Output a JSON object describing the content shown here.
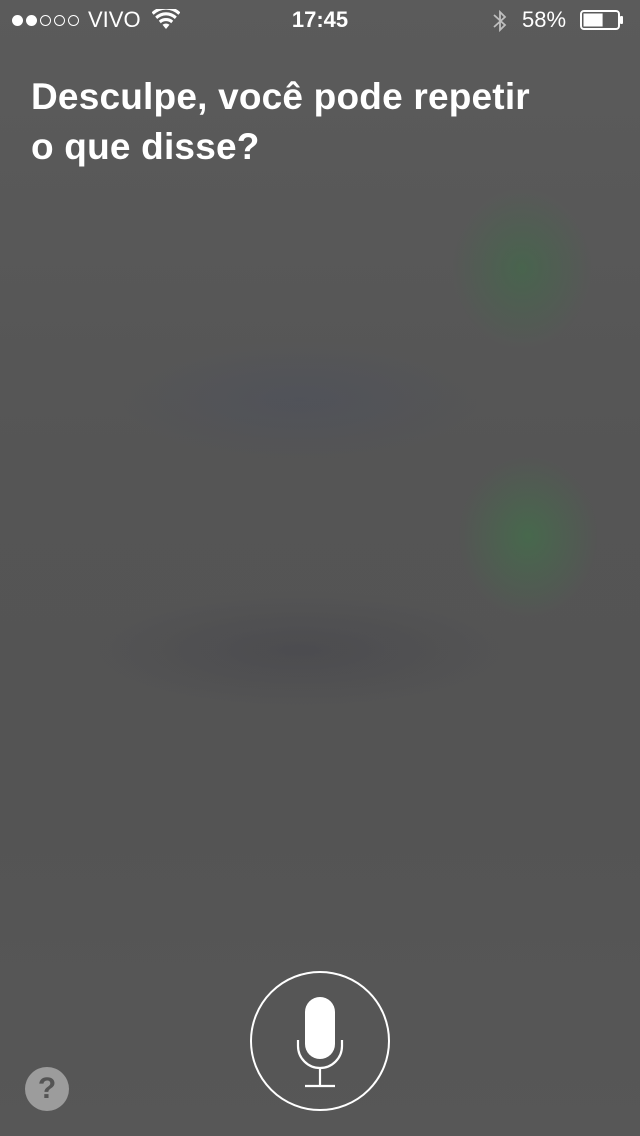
{
  "status_bar": {
    "signal_strength": 2,
    "signal_max": 5,
    "carrier": "VIVO",
    "time": "17:45",
    "battery_percent_label": "58%",
    "battery_level": 0.58,
    "icons": [
      "wifi-icon",
      "bluetooth-icon",
      "battery-icon"
    ]
  },
  "siri": {
    "prompt_line1": "Desculpe, você pode repetir",
    "prompt_line2": "o que disse?"
  },
  "controls": {
    "help_label": "?",
    "mic_icon": "microphone-icon"
  },
  "colors": {
    "background": "#545454",
    "text": "#ffffff",
    "help_bg": "#9c9c9c"
  }
}
